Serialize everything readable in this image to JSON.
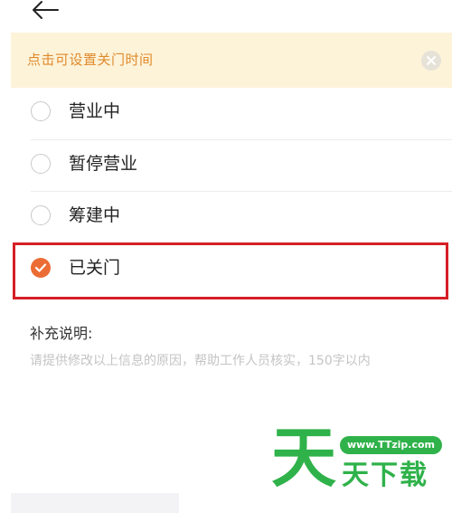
{
  "header": {
    "back_icon": "arrow-left-icon"
  },
  "notice": {
    "text": "点击可设置关门时间",
    "close_icon": "close-circle-icon"
  },
  "status_options": [
    {
      "label": "营业中",
      "checked": false
    },
    {
      "label": "暂停营业",
      "checked": false
    },
    {
      "label": "筹建中",
      "checked": false
    },
    {
      "label": "已关门",
      "checked": true
    }
  ],
  "supplement": {
    "label": "补充说明:",
    "placeholder": "请提供修改以上信息的原因，帮助工作人员核实，150字以内"
  },
  "watermark": {
    "big_char": "天",
    "url": "www.TTzip.com",
    "small_text": "天下载"
  },
  "colors": {
    "accent": "#ec6c35",
    "notice_bg": "#fdf3d9",
    "notice_text": "#e08a2c",
    "highlight": "#d61f26",
    "watermark": "#2fb24a"
  }
}
